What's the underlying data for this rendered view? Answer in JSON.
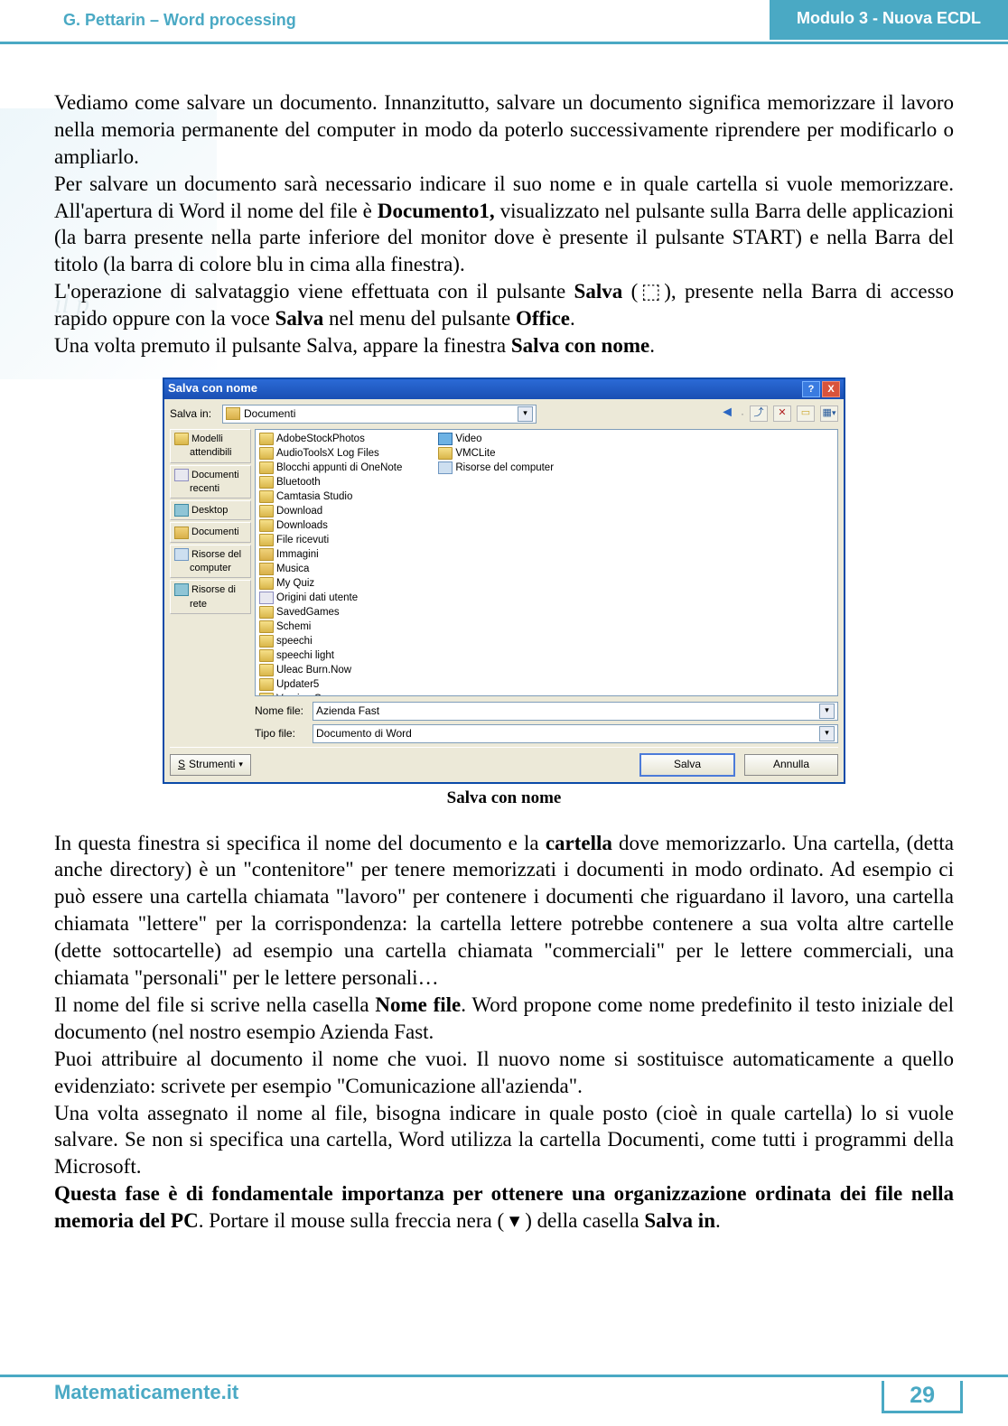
{
  "header": {
    "left": "G. Pettarin – Word processing",
    "right": "Modulo 3 - Nuova ECDL"
  },
  "watermark": "il p",
  "para1": {
    "a": "Vediamo come salvare un documento. Innanzitutto, salvare un documento significa memorizzare il lavoro nella memoria permanente del computer in modo da poterlo successivamente riprendere per modificarlo o ampliarlo.",
    "b1": "Per salvare un documento sarà necessario indicare il suo nome e in quale cartella si vuole memorizzare. All'apertura di Word il nome del file è ",
    "b2": "Documento1,",
    "b3": " visualizzato nel pulsante sulla Barra delle applicazioni (la barra presente nella parte inferiore del monitor dove è presente il pulsante START) e nella Barra del titolo (la barra di colore blu in cima alla finestra).",
    "c1": "L'operazione di salvataggio viene effettuata con il pulsante ",
    "c2": "Salva",
    "c3": " (⬚), presente nella Barra di accesso rapido oppure con la voce ",
    "c4": "Salva",
    "c5": " nel menu del pulsante ",
    "c6": "Office",
    "c7": ".",
    "d1": "Una volta premuto il pulsante Salva, appare la finestra ",
    "d2": "Salva con nome",
    "d3": "."
  },
  "dialog": {
    "title": "Salva con nome",
    "salva_in_lbl": "Salva in:",
    "salva_in_val": "Documenti",
    "places": [
      {
        "icon": "fld",
        "l1": "Modelli",
        "l2": "attendibili"
      },
      {
        "icon": "doc",
        "l1": "Documenti",
        "l2": "recenti"
      },
      {
        "icon": "desk",
        "l1": "Desktop",
        "l2": ""
      },
      {
        "icon": "my",
        "l1": "Documenti",
        "l2": ""
      },
      {
        "icon": "comp",
        "l1": "Risorse del",
        "l2": "computer"
      },
      {
        "icon": "net",
        "l1": "Risorse di",
        "l2": "rete"
      }
    ],
    "col1": [
      {
        "i": "fld",
        "t": "AdobeStockPhotos"
      },
      {
        "i": "fld",
        "t": "AudioToolsX Log Files"
      },
      {
        "i": "fld",
        "t": "Blocchi appunti di OneNote"
      },
      {
        "i": "fld",
        "t": "Bluetooth"
      },
      {
        "i": "fld",
        "t": "Camtasia Studio"
      },
      {
        "i": "fld",
        "t": "Download"
      },
      {
        "i": "fld",
        "t": "Downloads"
      },
      {
        "i": "fld",
        "t": "File ricevuti"
      },
      {
        "i": "my",
        "t": "Immagini"
      },
      {
        "i": "my",
        "t": "Musica"
      },
      {
        "i": "fld",
        "t": "My Quiz"
      },
      {
        "i": "doc",
        "t": "Origini dati utente"
      },
      {
        "i": "fld",
        "t": "SavedGames"
      },
      {
        "i": "fld",
        "t": "Schemi"
      },
      {
        "i": "fld",
        "t": "speechi"
      },
      {
        "i": "fld",
        "t": "speechi light"
      },
      {
        "i": "fld",
        "t": "Uleac Burn.Now"
      },
      {
        "i": "fld",
        "t": "Updater5"
      },
      {
        "i": "fld",
        "t": "Version Cue"
      }
    ],
    "col2": [
      {
        "i": "vid",
        "t": "Video"
      },
      {
        "i": "fld",
        "t": "VMCLite"
      },
      {
        "i": "comp",
        "t": "Risorse del computer"
      }
    ],
    "nome_lbl": "Nome file:",
    "nome_val": "Azienda Fast",
    "tipo_lbl": "Tipo file:",
    "tipo_val": "Documento di Word",
    "tools": "Strumenti",
    "save": "Salva",
    "cancel": "Annulla"
  },
  "caption": "Salva con nome",
  "para2": {
    "a1": "In questa finestra si specifica il nome del documento e la ",
    "a2": "cartella",
    "a3": " dove memorizzarlo. Una cartella, (detta anche directory) è un \"contenitore\" per tenere memorizzati i documenti in modo ordinato. Ad esempio ci può essere una cartella chiamata \"lavoro\" per contenere i documenti che riguardano il lavoro, una cartella chiamata \"lettere\" per la corrispondenza: la cartella lettere potrebbe contenere a sua volta altre cartelle (dette sottocartelle) ad esempio una cartella chiamata \"commerciali\" per le lettere commerciali, una chiamata \"personali\" per le lettere personali…",
    "b1": "Il nome del file si scrive nella casella ",
    "b2": "Nome file",
    "b3": ". Word propone come nome predefinito il testo iniziale del documento (nel nostro esempio Azienda Fast.",
    "c": "Puoi attribuire al documento il nome che vuoi. Il nuovo nome si sostituisce automaticamente a quello evidenziato: scrivete per esempio \"Comunicazione all'azienda\".",
    "d": "Una volta assegnato il nome al file, bisogna indicare in quale posto (cioè in quale cartella) lo si vuole salvare. Se non si specifica una cartella, Word utilizza la cartella Documenti, come tutti i programmi della Microsoft.",
    "e1": "Questa fase è di fondamentale importanza per ottenere una organizzazione ordinata dei file nella memoria del PC",
    "e2": ". Portare il mouse sulla freccia nera ( ▾ ) della casella ",
    "e3": "Salva in",
    "e4": "."
  },
  "footer": {
    "left": "Matematicamente.it",
    "page": "29"
  }
}
